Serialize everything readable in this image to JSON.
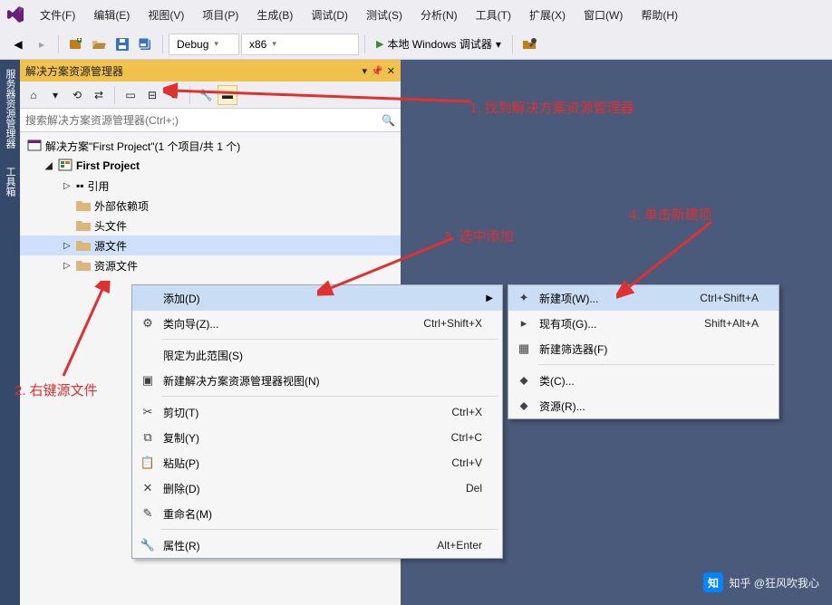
{
  "menu": {
    "items": [
      "文件(F)",
      "编辑(E)",
      "视图(V)",
      "项目(P)",
      "生成(B)",
      "调试(D)",
      "测试(S)",
      "分析(N)",
      "工具(T)",
      "扩展(X)",
      "窗口(W)",
      "帮助(H)"
    ]
  },
  "toolbar": {
    "config": "Debug",
    "platform": "x86",
    "runner": "本地 Windows 调试器"
  },
  "sidetabs": [
    "服务器资源管理器",
    "工具箱"
  ],
  "panel": {
    "title": "解决方案资源管理器",
    "search_placeholder": "搜索解决方案资源管理器(Ctrl+;)",
    "solution": "解决方案\"First Project\"(1 个项目/共 1 个)",
    "project": "First Project",
    "nodes": {
      "refs": "引用",
      "extdep": "外部依赖项",
      "headers": "头文件",
      "sources": "源文件",
      "resources": "资源文件"
    }
  },
  "ctx1": [
    {
      "label": "添加(D)",
      "short": "",
      "hover": true,
      "arrow": true
    },
    {
      "label": "类向导(Z)...",
      "short": "Ctrl+Shift+X",
      "icon": "wiz"
    },
    {
      "sep": true
    },
    {
      "label": "限定为此范围(S)"
    },
    {
      "label": "新建解决方案资源管理器视图(N)",
      "icon": "view"
    },
    {
      "sep": true
    },
    {
      "label": "剪切(T)",
      "short": "Ctrl+X",
      "icon": "cut"
    },
    {
      "label": "复制(Y)",
      "short": "Ctrl+C",
      "icon": "copy"
    },
    {
      "label": "粘贴(P)",
      "short": "Ctrl+V",
      "icon": "paste"
    },
    {
      "label": "删除(D)",
      "short": "Del",
      "icon": "del"
    },
    {
      "label": "重命名(M)",
      "icon": "ren"
    },
    {
      "sep": true
    },
    {
      "label": "属性(R)",
      "short": "Alt+Enter",
      "icon": "prop"
    }
  ],
  "ctx2": [
    {
      "label": "新建项(W)...",
      "short": "Ctrl+Shift+A",
      "hover": true,
      "icon": "new"
    },
    {
      "label": "现有项(G)...",
      "short": "Shift+Alt+A",
      "icon": "exist"
    },
    {
      "label": "新建筛选器(F)",
      "icon": "filter"
    },
    {
      "sep": true
    },
    {
      "label": "类(C)...",
      "icon": "cls"
    },
    {
      "label": "资源(R)...",
      "icon": "res"
    }
  ],
  "anno": {
    "a1": "1. 找到解决方案资源管理器",
    "a2": "2. 右键源文件",
    "a3": "3. 选中添加",
    "a4": "4. 单击新建项"
  },
  "watermark": "知乎 @狂风吹我心"
}
